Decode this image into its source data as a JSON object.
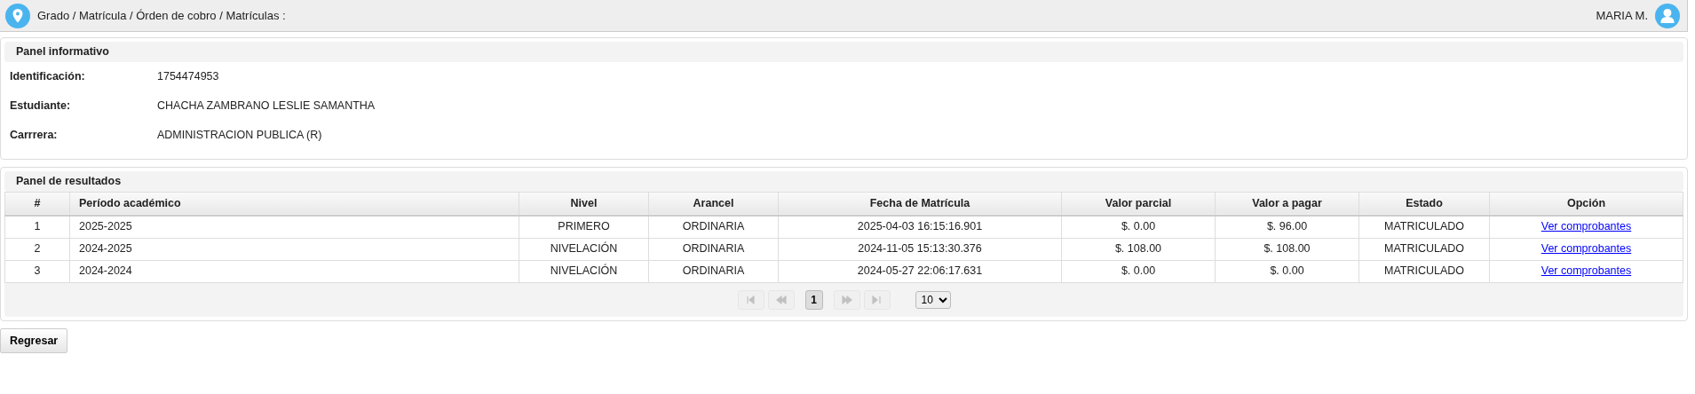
{
  "header": {
    "breadcrumb": "Grado / Matrícula / Órden de cobro / Matrículas :",
    "user": "MARIA M."
  },
  "info_panel": {
    "title": "Panel informativo",
    "fields": [
      {
        "label": "Identificación:",
        "value": "1754474953"
      },
      {
        "label": "Estudiante:",
        "value": "CHACHA ZAMBRANO LESLIE SAMANTHA"
      },
      {
        "label": "Carrrera:",
        "value": "ADMINISTRACION PUBLICA (R)"
      }
    ]
  },
  "results_panel": {
    "title": "Panel de resultados",
    "table": {
      "columns": [
        "#",
        "Período académico",
        "Nivel",
        "Arancel",
        "Fecha de Matrícula",
        "Valor parcial",
        "Valor a pagar",
        "Estado",
        "Opción"
      ],
      "rows": [
        {
          "cells": [
            "1",
            "2025-2025",
            "PRIMERO",
            "ORDINARIA",
            "2025-04-03 16:15:16.901",
            "$. 0.00",
            "$. 96.00",
            "MATRICULADO"
          ],
          "link": "Ver comprobantes"
        },
        {
          "cells": [
            "2",
            "2024-2025",
            "NIVELACIÓN",
            "ORDINARIA",
            "2024-11-05 15:13:30.376",
            "$. 108.00",
            "$. 108.00",
            "MATRICULADO"
          ],
          "link": "Ver comprobantes"
        },
        {
          "cells": [
            "3",
            "2024-2024",
            "NIVELACIÓN",
            "ORDINARIA",
            "2024-05-27 22:06:17.631",
            "$. 0.00",
            "$. 0.00",
            "MATRICULADO"
          ],
          "link": "Ver comprobantes"
        }
      ]
    },
    "pager": {
      "nav": [
        {
          "kind": "first",
          "disabled": true
        },
        {
          "kind": "prev",
          "disabled": true
        }
      ],
      "pages": [
        {
          "label": "1",
          "selected": true
        }
      ],
      "nav_after": [
        {
          "kind": "next",
          "disabled": true
        },
        {
          "kind": "last",
          "disabled": true
        }
      ],
      "page_size": "10"
    }
  },
  "buttons": [
    "Regresar"
  ]
}
